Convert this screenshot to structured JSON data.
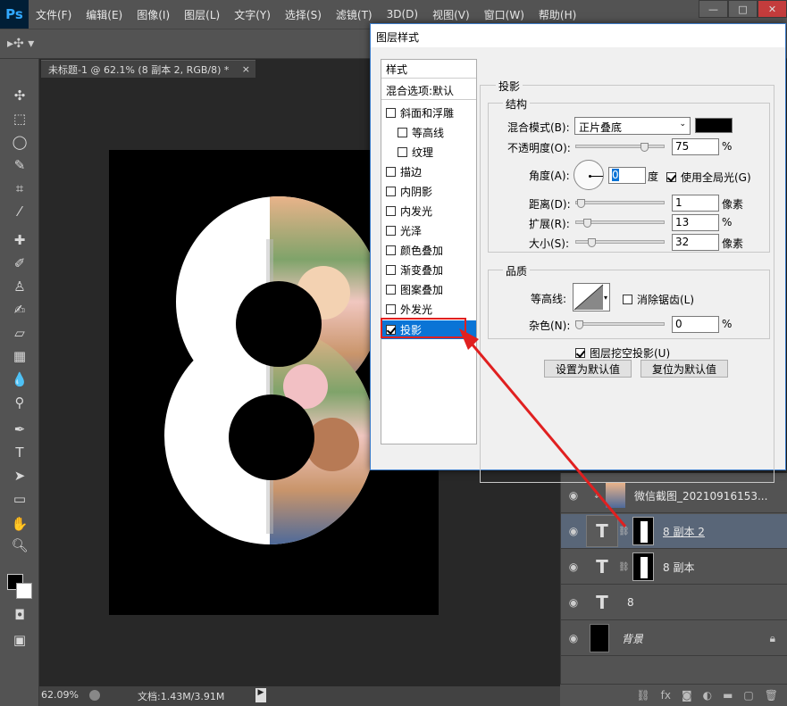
{
  "app": {
    "logo": "Ps",
    "menu": [
      "文件(F)",
      "编辑(E)",
      "图像(I)",
      "图层(L)",
      "文字(Y)",
      "选择(S)",
      "滤镜(T)",
      "3D(D)",
      "视图(V)",
      "窗口(W)",
      "帮助(H)"
    ],
    "window_controls": [
      "—",
      "□",
      "✕"
    ]
  },
  "document": {
    "tab_title": "未标题-1 @ 62.1% (8 副本 2, RGB/8) *",
    "tab_close": "×",
    "canvas_glyph": "8"
  },
  "status": {
    "zoom": "62.09%",
    "doc_info": "文档:1.43M/3.91M"
  },
  "layers": [
    {
      "name": "微信截图_20210916153...",
      "kind": "image",
      "selected": false
    },
    {
      "name": "8 副本 2",
      "kind": "text-masked",
      "selected": true
    },
    {
      "name": "8 副本",
      "kind": "text-masked",
      "selected": false
    },
    {
      "name": "8",
      "kind": "text",
      "selected": false
    },
    {
      "name": "背景",
      "kind": "background",
      "selected": false
    }
  ],
  "dialog": {
    "title": "图层样式",
    "style_header": "样式",
    "blend_options": "混合选项:默认",
    "styles": [
      {
        "label": "斜面和浮雕",
        "checked": false,
        "indent": false
      },
      {
        "label": "等高线",
        "checked": false,
        "indent": true
      },
      {
        "label": "纹理",
        "checked": false,
        "indent": true
      },
      {
        "label": "描边",
        "checked": false,
        "indent": false
      },
      {
        "label": "内阴影",
        "checked": false,
        "indent": false
      },
      {
        "label": "内发光",
        "checked": false,
        "indent": false
      },
      {
        "label": "光泽",
        "checked": false,
        "indent": false
      },
      {
        "label": "颜色叠加",
        "checked": false,
        "indent": false
      },
      {
        "label": "渐变叠加",
        "checked": false,
        "indent": false
      },
      {
        "label": "图案叠加",
        "checked": false,
        "indent": false
      },
      {
        "label": "外发光",
        "checked": false,
        "indent": false
      },
      {
        "label": "投影",
        "checked": true,
        "indent": false
      }
    ],
    "section_title": "投影",
    "structure": {
      "title": "结构",
      "blend_mode_label": "混合模式(B):",
      "blend_mode_value": "正片叠底",
      "shadow_color": "#000000",
      "opacity_label": "不透明度(O):",
      "opacity_value": "75",
      "opacity_unit": "%",
      "angle_label": "角度(A):",
      "angle_value": "0",
      "angle_unit": "度",
      "global_light_label": "使用全局光(G)",
      "global_light_checked": true,
      "distance_label": "距离(D):",
      "distance_value": "1",
      "distance_unit": "像素",
      "spread_label": "扩展(R):",
      "spread_value": "13",
      "spread_unit": "%",
      "size_label": "大小(S):",
      "size_value": "32",
      "size_unit": "像素"
    },
    "quality": {
      "title": "品质",
      "contour_label": "等高线:",
      "antialias_label": "消除锯齿(L)",
      "noise_label": "杂色(N):",
      "noise_value": "0",
      "noise_unit": "%"
    },
    "knockout_label": "图层挖空投影(U)",
    "make_default": "设置为默认值",
    "reset_default": "复位为默认值"
  },
  "colors": {
    "accent_red": "#e02020",
    "selection_blue": "#0a74d6"
  }
}
